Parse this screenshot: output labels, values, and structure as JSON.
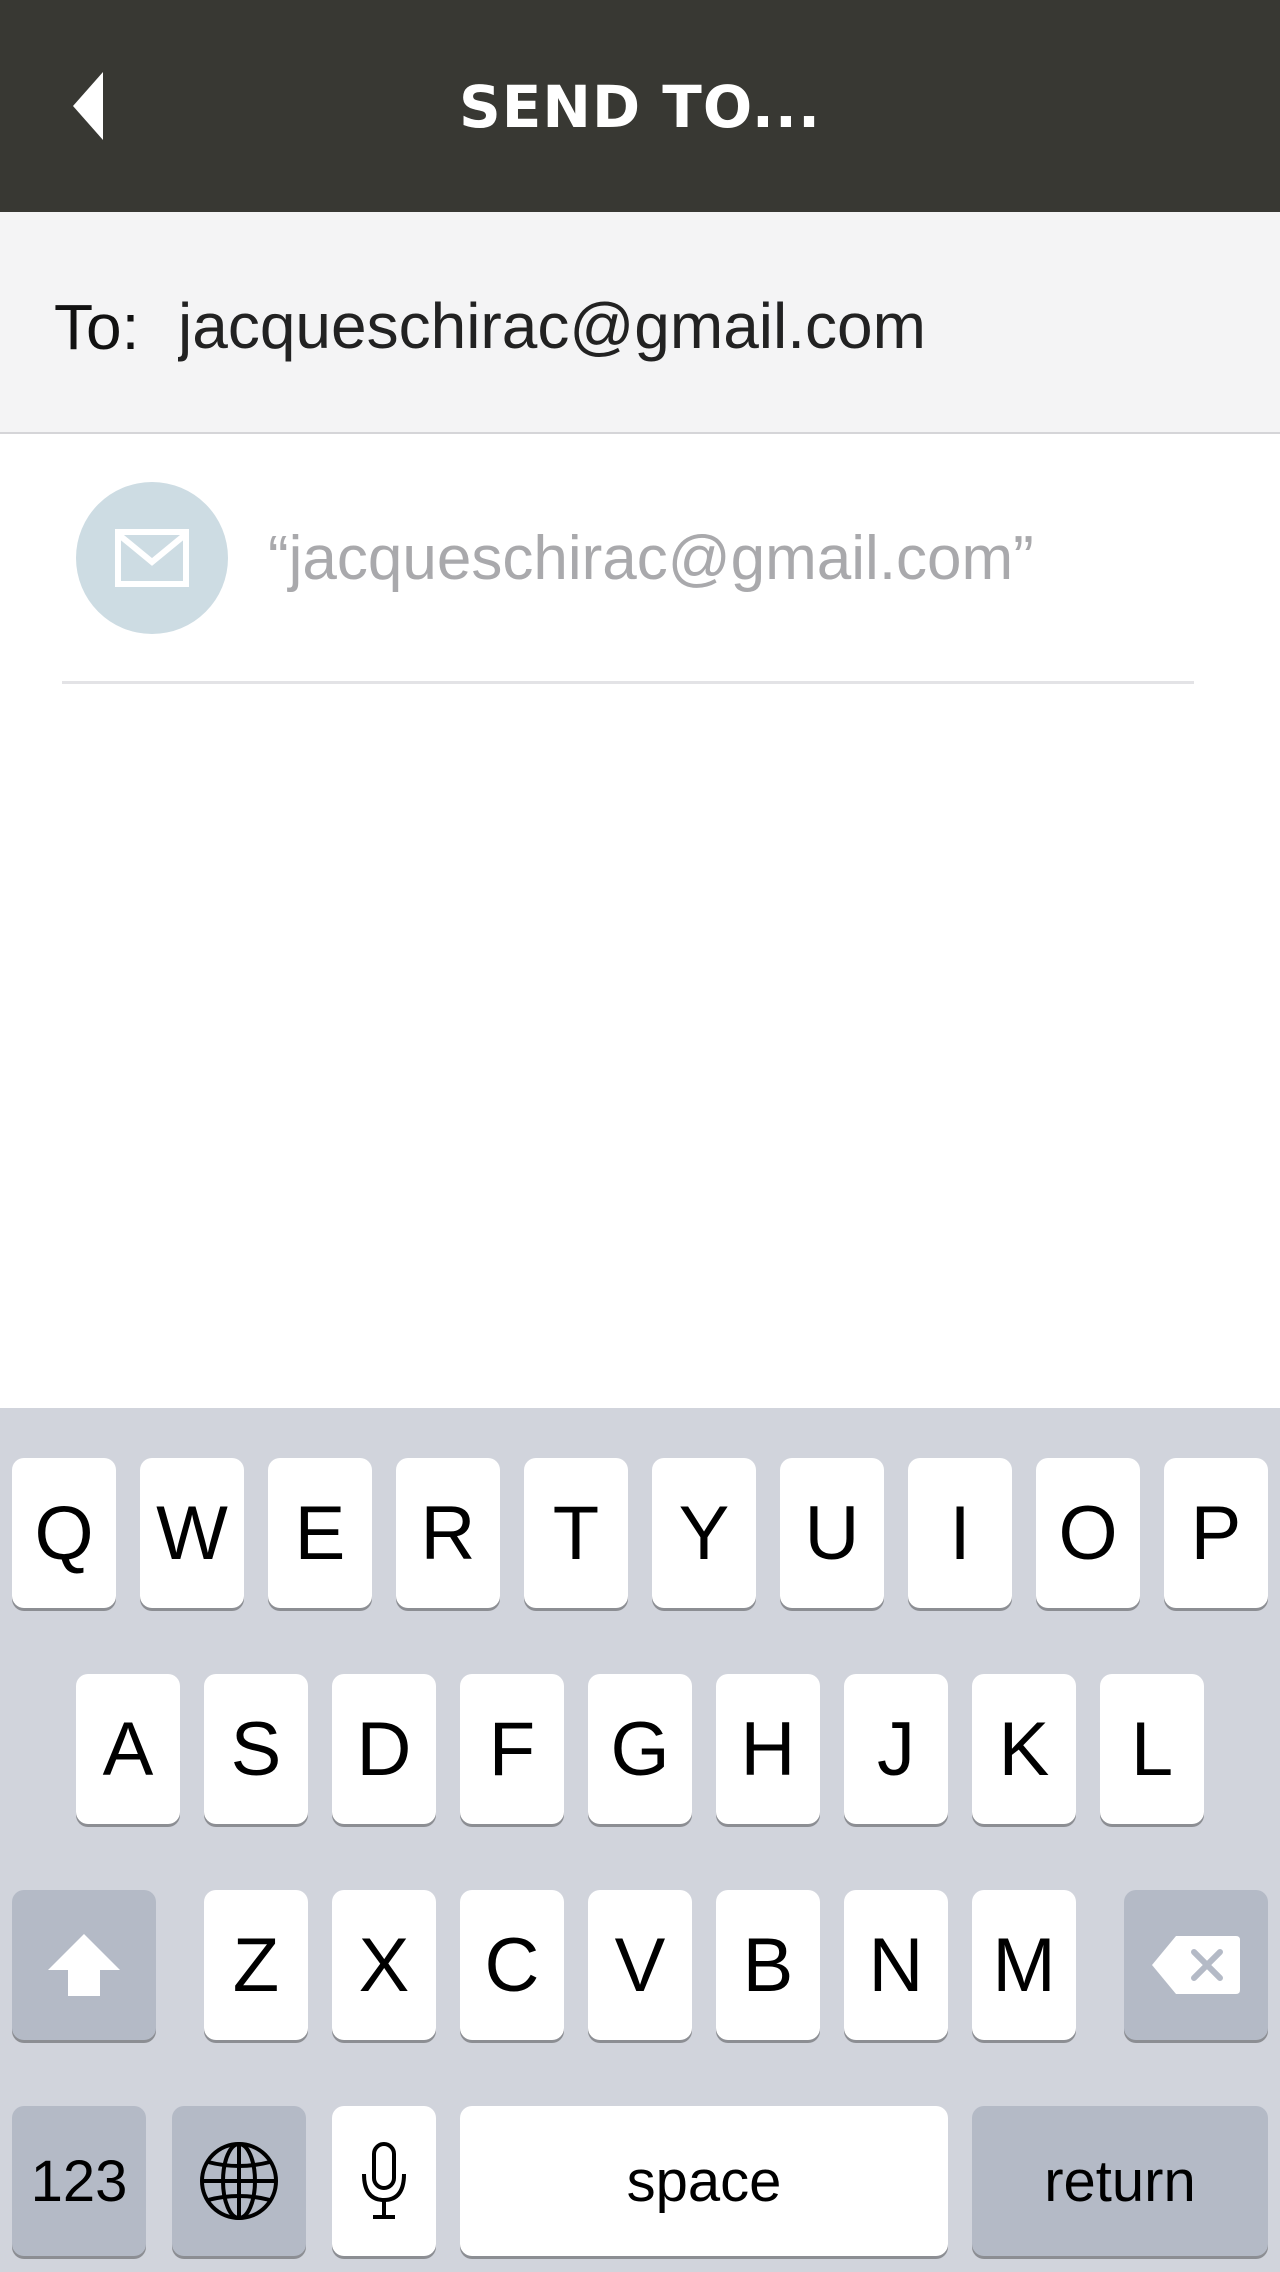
{
  "header": {
    "title": "SEND TO...",
    "back_icon": "back-arrow-icon",
    "background_color": "#383833"
  },
  "to_field": {
    "label": "To:",
    "value": "jacqueschirac@gmail.com"
  },
  "suggestion": {
    "icon": "envelope-icon",
    "text": "“jacqueschirac@gmail.com”"
  },
  "keyboard": {
    "row1": [
      "Q",
      "W",
      "E",
      "R",
      "T",
      "Y",
      "U",
      "I",
      "O",
      "P"
    ],
    "row2": [
      "A",
      "S",
      "D",
      "F",
      "G",
      "H",
      "J",
      "K",
      "L"
    ],
    "row3": [
      "Z",
      "X",
      "C",
      "V",
      "B",
      "N",
      "M"
    ],
    "shift_icon": "shift-arrow-icon",
    "backspace_icon": "backspace-icon",
    "numbers_label": "123",
    "globe_icon": "globe-icon",
    "mic_icon": "microphone-icon",
    "space_label": "space",
    "return_label": "return"
  }
}
